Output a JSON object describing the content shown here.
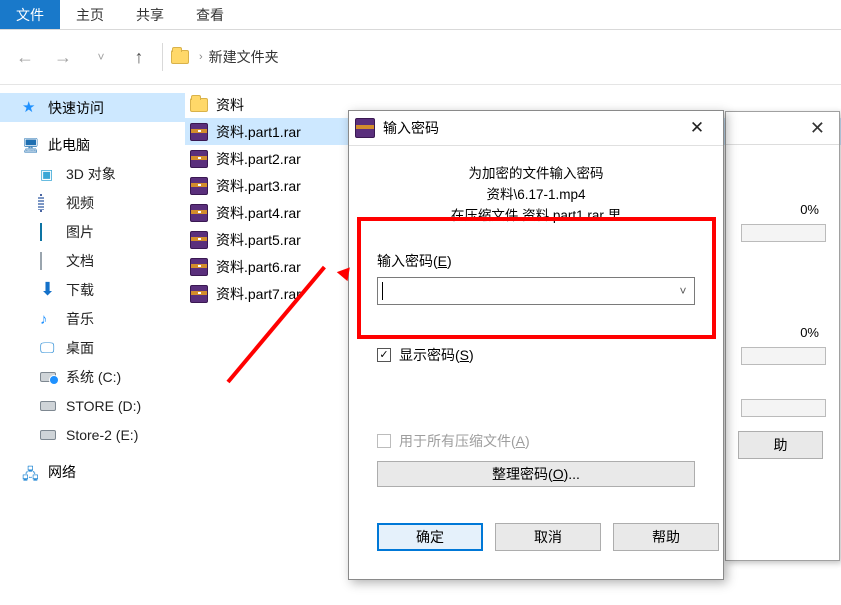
{
  "ribbon": {
    "tabs": [
      "文件",
      "主页",
      "共享",
      "查看"
    ]
  },
  "address": {
    "folder_name": "新建文件夹",
    "sep": "›"
  },
  "sidebar": {
    "quick_access": "快速访问",
    "this_pc": "此电脑",
    "children": [
      {
        "label": "3D 对象"
      },
      {
        "label": "视频"
      },
      {
        "label": "图片"
      },
      {
        "label": "文档"
      },
      {
        "label": "下载"
      },
      {
        "label": "音乐"
      },
      {
        "label": "桌面"
      },
      {
        "label": "系统 (C:)"
      },
      {
        "label": "STORE (D:)"
      },
      {
        "label": "Store-2 (E:)"
      }
    ],
    "network": "网络"
  },
  "files": {
    "folder": "资料",
    "items": [
      "资料.part1.rar",
      "资料.part2.rar",
      "资料.part3.rar",
      "资料.part4.rar",
      "资料.part5.rar",
      "资料.part6.rar",
      "资料.part7.rar"
    ]
  },
  "bg_dialog": {
    "pct1": "0%",
    "pct2": "0%",
    "help_btn": "助"
  },
  "pwd_dialog": {
    "title": "输入密码",
    "line1": "为加密的文件输入密码",
    "line2": "资料\\6.17-1.mp4",
    "line3": "在压缩文件 资料.part1.rar 里",
    "input_label_pre": "输入密码(",
    "input_label_key": "E",
    "input_label_post": ")",
    "show_pwd_pre": "显示密码(",
    "show_pwd_key": "S",
    "show_pwd_post": ")",
    "all_archives_pre": "用于所有压缩文件(",
    "all_archives_key": "A",
    "all_archives_post": ")",
    "organize_pre": "整理密码(",
    "organize_key": "O",
    "organize_post": ")...",
    "ok": "确定",
    "cancel": "取消",
    "help": "帮助"
  }
}
